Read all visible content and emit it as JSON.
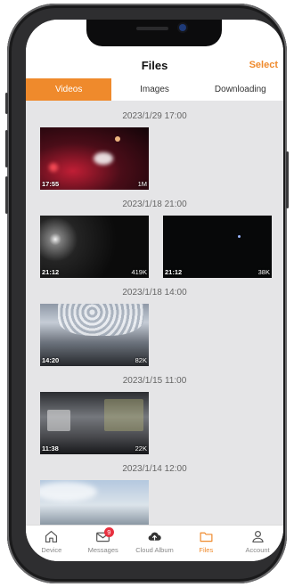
{
  "header": {
    "title": "Files",
    "select_label": "Select"
  },
  "tabs": [
    {
      "label": "Videos",
      "active": true
    },
    {
      "label": "Images",
      "active": false
    },
    {
      "label": "Downloading",
      "active": false
    }
  ],
  "groups": [
    {
      "date": "2023/1/29 17:00",
      "clips": [
        {
          "time": "17:55",
          "size": "1M"
        }
      ]
    },
    {
      "date": "2023/1/18 21:00",
      "clips": [
        {
          "time": "21:12",
          "size": "419K"
        },
        {
          "time": "21:12",
          "size": "38K"
        }
      ]
    },
    {
      "date": "2023/1/18 14:00",
      "clips": [
        {
          "time": "14:20",
          "size": "82K"
        }
      ]
    },
    {
      "date": "2023/1/15 11:00",
      "clips": [
        {
          "time": "11:38",
          "size": "22K"
        }
      ]
    },
    {
      "date": "2023/1/14 12:00",
      "clips": [
        {}
      ]
    }
  ],
  "tabbar": [
    {
      "label": "Device",
      "icon": "house-icon"
    },
    {
      "label": "Messages",
      "icon": "envelope-icon",
      "badge": "9"
    },
    {
      "label": "Cloud Album",
      "icon": "cloud-upload-icon"
    },
    {
      "label": "Files",
      "icon": "folder-icon",
      "active": true
    },
    {
      "label": "Account",
      "icon": "person-icon"
    }
  ],
  "colors": {
    "accent": "#ef8a2c",
    "badge": "#e8303f",
    "list_background": "#e5e5e7"
  }
}
